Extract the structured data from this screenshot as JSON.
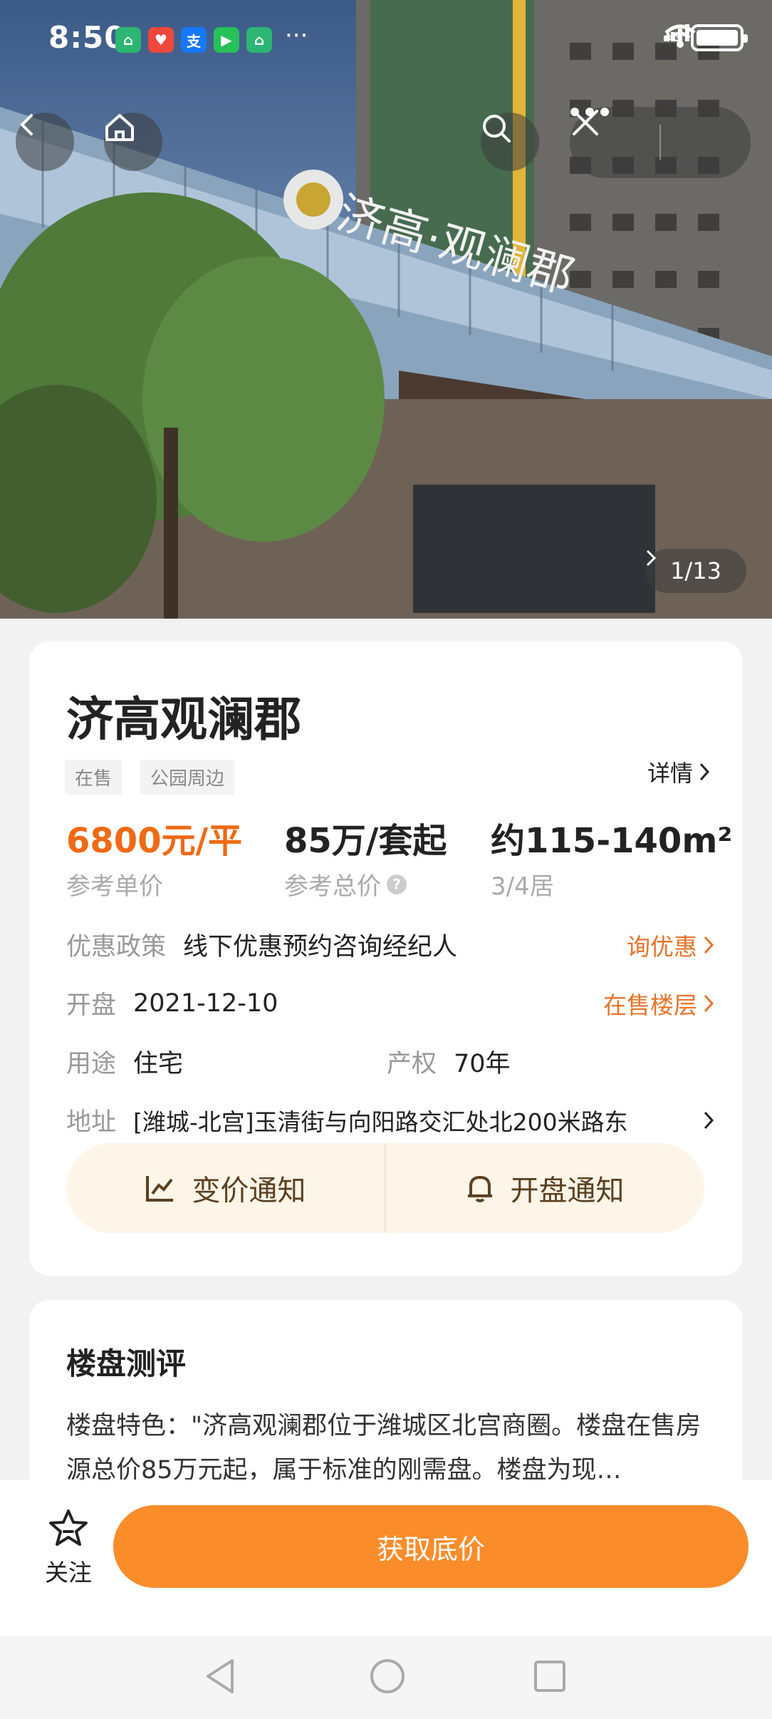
{
  "status_bar": {
    "time": "8:50",
    "network": "4G",
    "notification_apps": [
      {
        "icon": "home-app-icon",
        "color": "#2bb673"
      },
      {
        "icon": "pdd-app-icon",
        "color": "#f0473c"
      },
      {
        "icon": "alipay-app-icon",
        "color": "#1677ff",
        "glyph": "支"
      },
      {
        "icon": "video-app-icon",
        "color": "#27c15c"
      },
      {
        "icon": "home-app-icon-2",
        "color": "#2bb673"
      }
    ],
    "more": "···"
  },
  "gallery": {
    "counter": "1/13"
  },
  "project": {
    "name": "济高观澜郡",
    "tags": [
      "在售",
      "公园周边"
    ],
    "detail_link": "详情"
  },
  "prices": {
    "unit_price": "6800元/平",
    "unit_price_label": "参考单价",
    "total_price": "85万/套起",
    "total_price_label": "参考总价",
    "area": "约115-140m²",
    "layout": "3/4居"
  },
  "info": {
    "discount_label": "优惠政策",
    "discount_value": "线下优惠预约咨询经纪人",
    "discount_link": "询优惠",
    "opening_label": "开盘",
    "opening_value": "2021-12-10",
    "opening_link": "在售楼层",
    "usage_label": "用途",
    "usage_value": "住宅",
    "tenure_label": "产权",
    "tenure_value": "70年",
    "address_label": "地址",
    "address_value": "[潍城-北宫]玉清街与向阳路交汇处北200米路东"
  },
  "notify": {
    "price_change": "变价通知",
    "opening": "开盘通知"
  },
  "review": {
    "title": "楼盘测评",
    "text": "楼盘特色：\"济高观澜郡位于潍城区北宫商圈。楼盘在售房源总价85万元起，属于标准的刚需盘。楼盘为现…"
  },
  "bottom": {
    "follow": "关注",
    "cta": "获取底价"
  },
  "colors": {
    "accent_orange": "#ef6a14",
    "cta_orange": "#fb8c2a",
    "notify_bg": "#fdf5e8"
  }
}
